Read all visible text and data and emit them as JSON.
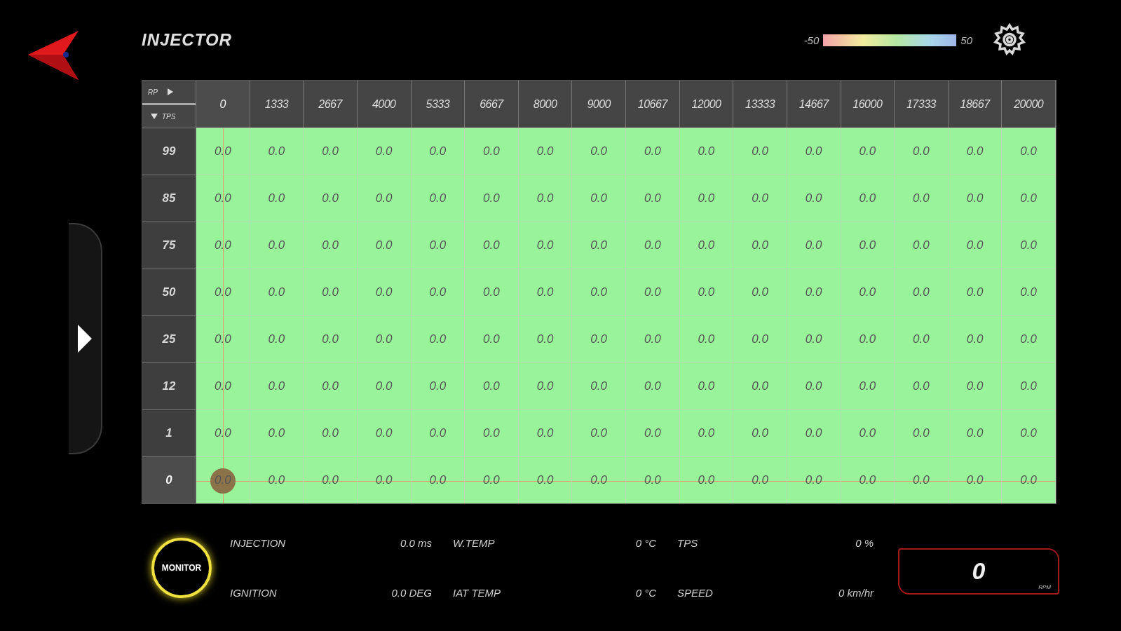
{
  "header": {
    "title": "INJECTOR",
    "scale": {
      "min_label": "-50",
      "max_label": "50"
    }
  },
  "table": {
    "corner": {
      "x_label": "RP",
      "y_label": "TPS"
    },
    "columns": [
      {
        "label": "0",
        "selected": true
      },
      {
        "label": "1333",
        "selected": false
      },
      {
        "label": "2667",
        "selected": false
      },
      {
        "label": "4000",
        "selected": false
      },
      {
        "label": "5333",
        "selected": false
      },
      {
        "label": "6667",
        "selected": false
      },
      {
        "label": "8000",
        "selected": false
      },
      {
        "label": "9000",
        "selected": false
      },
      {
        "label": "10667",
        "selected": false
      },
      {
        "label": "12000",
        "selected": false
      },
      {
        "label": "13333",
        "selected": false
      },
      {
        "label": "14667",
        "selected": false
      },
      {
        "label": "16000",
        "selected": false
      },
      {
        "label": "17333",
        "selected": false
      },
      {
        "label": "18667",
        "selected": false
      },
      {
        "label": "20000",
        "selected": false
      }
    ],
    "rows": [
      {
        "label": "99",
        "selected": false,
        "cells": [
          "0.0",
          "0.0",
          "0.0",
          "0.0",
          "0.0",
          "0.0",
          "0.0",
          "0.0",
          "0.0",
          "0.0",
          "0.0",
          "0.0",
          "0.0",
          "0.0",
          "0.0",
          "0.0"
        ]
      },
      {
        "label": "85",
        "selected": false,
        "cells": [
          "0.0",
          "0.0",
          "0.0",
          "0.0",
          "0.0",
          "0.0",
          "0.0",
          "0.0",
          "0.0",
          "0.0",
          "0.0",
          "0.0",
          "0.0",
          "0.0",
          "0.0",
          "0.0"
        ]
      },
      {
        "label": "75",
        "selected": false,
        "cells": [
          "0.0",
          "0.0",
          "0.0",
          "0.0",
          "0.0",
          "0.0",
          "0.0",
          "0.0",
          "0.0",
          "0.0",
          "0.0",
          "0.0",
          "0.0",
          "0.0",
          "0.0",
          "0.0"
        ]
      },
      {
        "label": "50",
        "selected": false,
        "cells": [
          "0.0",
          "0.0",
          "0.0",
          "0.0",
          "0.0",
          "0.0",
          "0.0",
          "0.0",
          "0.0",
          "0.0",
          "0.0",
          "0.0",
          "0.0",
          "0.0",
          "0.0",
          "0.0"
        ]
      },
      {
        "label": "25",
        "selected": false,
        "cells": [
          "0.0",
          "0.0",
          "0.0",
          "0.0",
          "0.0",
          "0.0",
          "0.0",
          "0.0",
          "0.0",
          "0.0",
          "0.0",
          "0.0",
          "0.0",
          "0.0",
          "0.0",
          "0.0"
        ]
      },
      {
        "label": "12",
        "selected": false,
        "cells": [
          "0.0",
          "0.0",
          "0.0",
          "0.0",
          "0.0",
          "0.0",
          "0.0",
          "0.0",
          "0.0",
          "0.0",
          "0.0",
          "0.0",
          "0.0",
          "0.0",
          "0.0",
          "0.0"
        ]
      },
      {
        "label": "1",
        "selected": false,
        "cells": [
          "0.0",
          "0.0",
          "0.0",
          "0.0",
          "0.0",
          "0.0",
          "0.0",
          "0.0",
          "0.0",
          "0.0",
          "0.0",
          "0.0",
          "0.0",
          "0.0",
          "0.0",
          "0.0"
        ]
      },
      {
        "label": "0",
        "selected": true,
        "cells": [
          "0.0",
          "0.0",
          "0.0",
          "0.0",
          "0.0",
          "0.0",
          "0.0",
          "0.0",
          "0.0",
          "0.0",
          "0.0",
          "0.0",
          "0.0",
          "0.0",
          "0.0",
          "0.0"
        ]
      }
    ]
  },
  "monitor_button": {
    "label": "MONITOR"
  },
  "stats": [
    {
      "items": [
        {
          "label": "INJECTION",
          "value": "0.0 ms"
        },
        {
          "label": "W.TEMP",
          "value": "0 °C"
        },
        {
          "label": "TPS",
          "value": "0 %"
        }
      ]
    },
    {
      "items": [
        {
          "label": "IGNITION",
          "value": "0.0 DEG"
        },
        {
          "label": "IAT TEMP",
          "value": "0 °C"
        },
        {
          "label": "SPEED",
          "value": "0 km/hr"
        }
      ]
    }
  ],
  "rpm": {
    "value": "0",
    "unit": "RPM"
  }
}
